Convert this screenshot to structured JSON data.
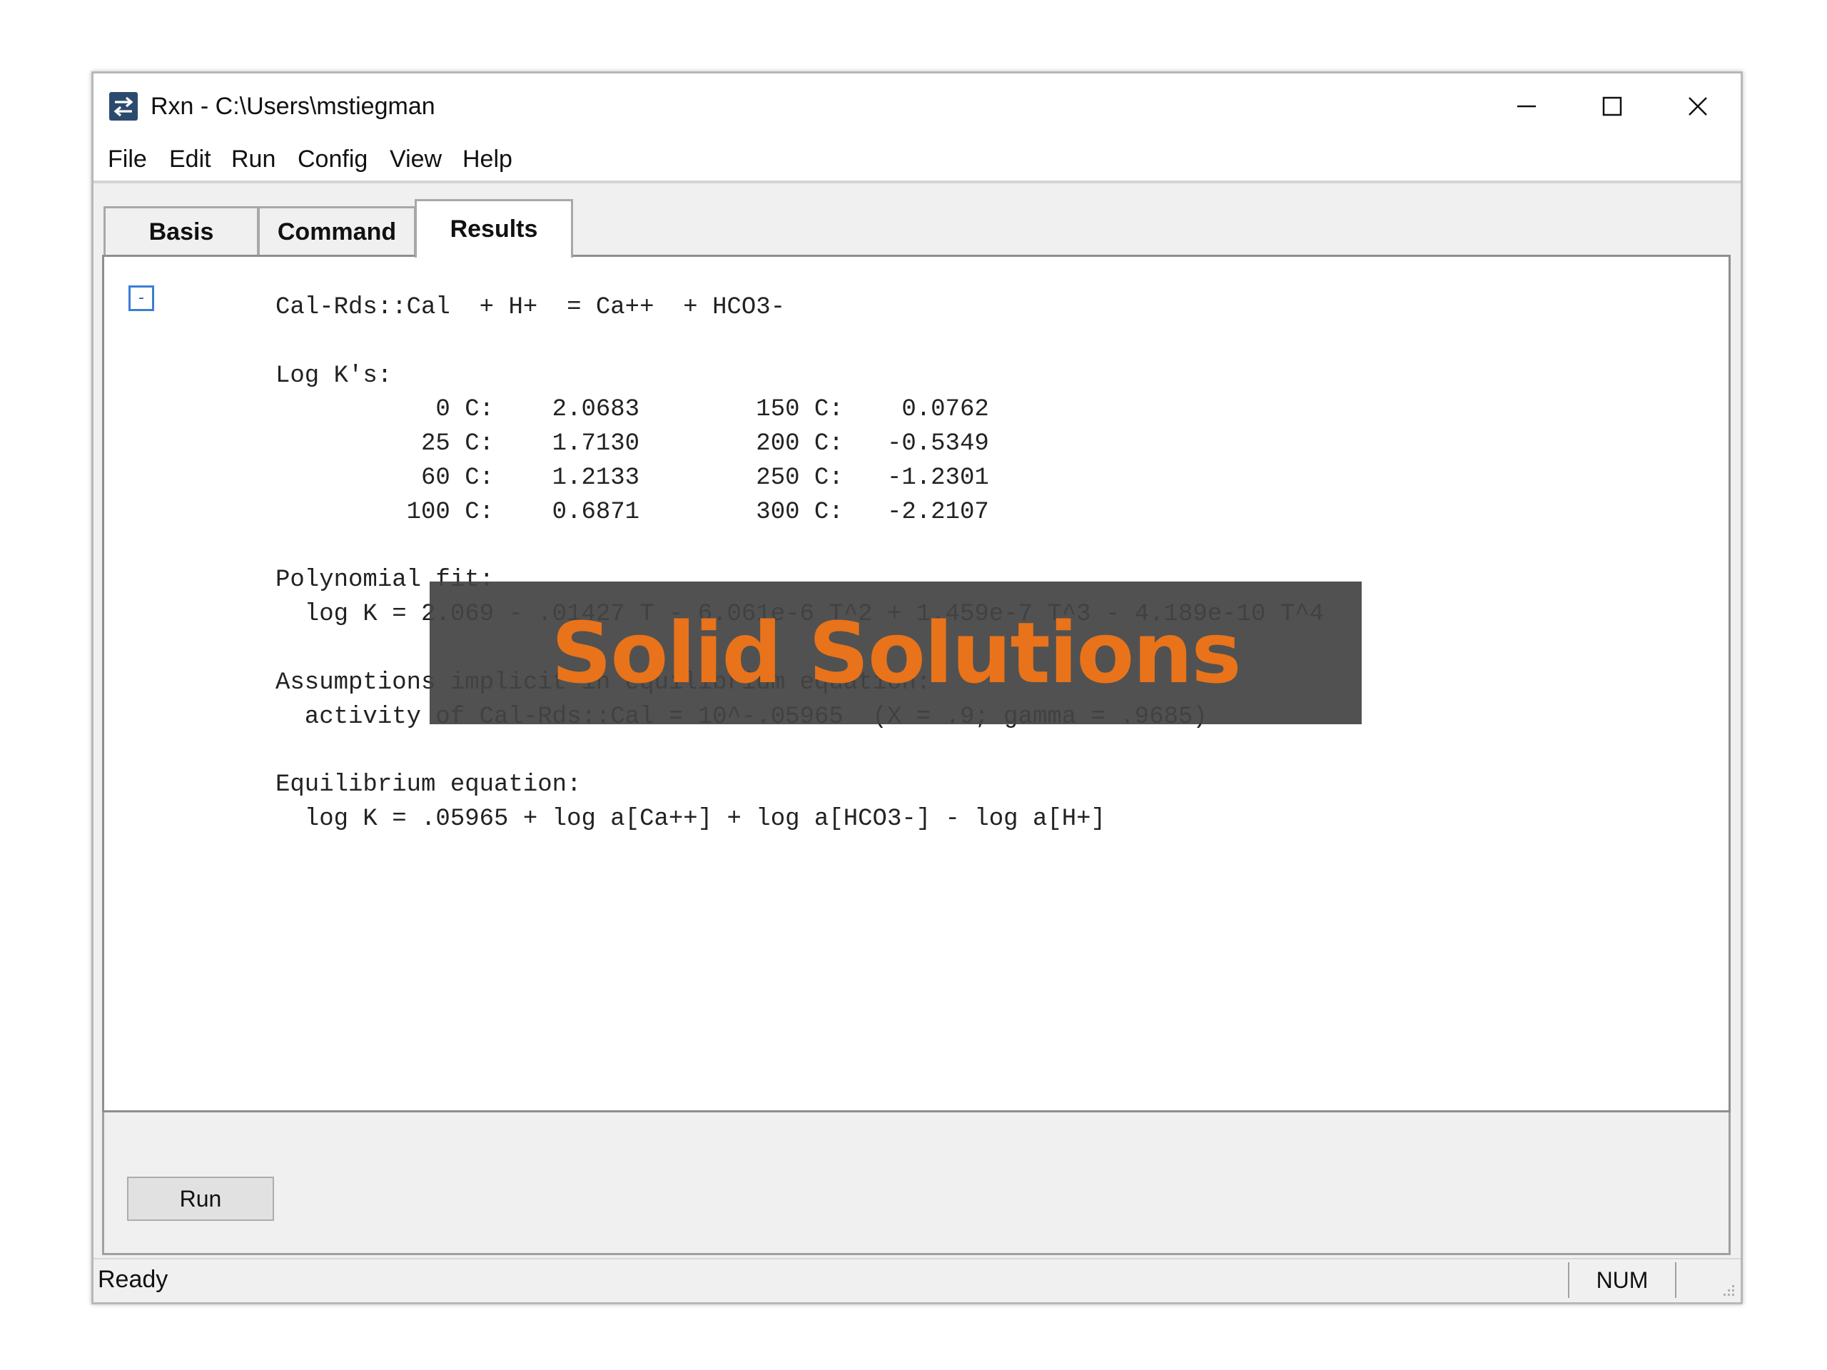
{
  "window": {
    "title": "Rxn - C:\\Users\\mstiegman",
    "app_icon": "swap-arrows-icon",
    "controls": [
      "minimize-icon",
      "maximize-icon",
      "close-icon"
    ]
  },
  "menu": [
    "File",
    "Edit",
    "Run",
    "Config",
    "View",
    "Help"
  ],
  "tabs": [
    {
      "label": "Basis",
      "active": false
    },
    {
      "label": "Command",
      "active": false
    },
    {
      "label": "Results",
      "active": true
    }
  ],
  "results": {
    "collapse_toggle": "-",
    "text": "Cal-Rds::Cal  + H+  = Ca++  + HCO3-\n\nLog K's:\n           0 C:    2.0683        150 C:    0.0762\n          25 C:    1.7130        200 C:   -0.5349\n          60 C:    1.2133        250 C:   -1.2301\n         100 C:    0.6871        300 C:   -2.2107\n\nPolynomial fit:\n  log K = 2.069 - .01427 T - 6.061e-6 T^2 + 1.459e-7 T^3 - 4.189e-10 T^4\n\nAssumptions implicit in equilibrium equation:\n  activity of Cal-Rds::Cal = 10^-.05965  (X = .9; gamma = .9685)\n\nEquilibrium equation:\n  log K = .05965 + log a[Ca++] + log a[HCO3-] - log a[H+]"
  },
  "run_button": "Run",
  "status": {
    "text": "Ready",
    "num": "NUM"
  },
  "overlay": {
    "text": "Solid Solutions",
    "text_color": "#e8731a",
    "background": "#444444"
  }
}
